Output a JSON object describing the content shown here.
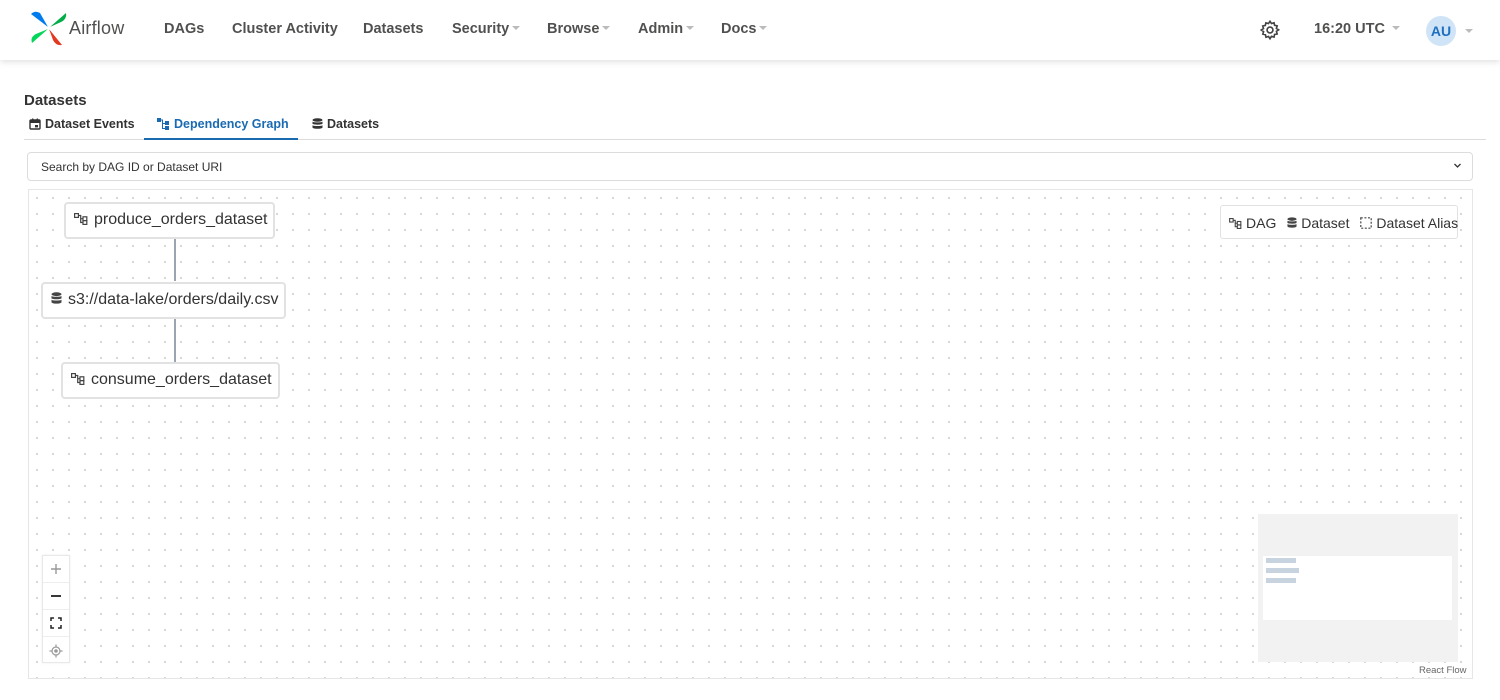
{
  "app": {
    "brand": "Airflow",
    "accent_color": "#1a6ab1"
  },
  "navbar": {
    "items": [
      {
        "label": "DAGs",
        "has_caret": false
      },
      {
        "label": "Cluster Activity",
        "has_caret": false
      },
      {
        "label": "Datasets",
        "has_caret": false
      },
      {
        "label": "Security",
        "has_caret": true
      },
      {
        "label": "Browse",
        "has_caret": true
      },
      {
        "label": "Admin",
        "has_caret": true
      },
      {
        "label": "Docs",
        "has_caret": true
      }
    ],
    "settings_icon": "gear-icon",
    "time": "16:20 UTC",
    "user_initials": "AU"
  },
  "page": {
    "title": "Datasets",
    "tabs": [
      {
        "label": "Dataset Events",
        "icon": "calendar-icon",
        "active": false
      },
      {
        "label": "Dependency Graph",
        "icon": "graph-icon",
        "active": true
      },
      {
        "label": "Datasets",
        "icon": "database-icon",
        "active": false
      }
    ]
  },
  "search": {
    "placeholder": "Search by DAG ID or Dataset URI"
  },
  "graph": {
    "nodes": [
      {
        "label": "produce_orders_dataset",
        "kind": "dag"
      },
      {
        "label": "s3://data-lake/orders/daily.csv",
        "kind": "dataset"
      },
      {
        "label": "consume_orders_dataset",
        "kind": "dag"
      }
    ],
    "legend": {
      "dag": "DAG",
      "dataset": "Dataset",
      "dataset_alias": "Dataset Alias"
    },
    "attribution": "React Flow"
  }
}
